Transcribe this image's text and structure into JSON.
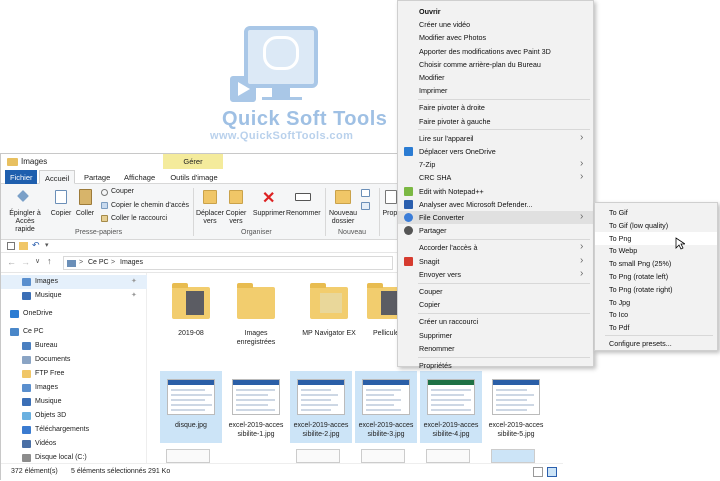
{
  "brand": {
    "title": "Quick Soft Tools",
    "url": "www.QuickSoftTools.com"
  },
  "explorer": {
    "window_title": "Images",
    "contextual_tab_header": "Gérer",
    "tabs": [
      "Fichier",
      "Accueil",
      "Partage",
      "Affichage",
      "Outils d'image"
    ],
    "ribbon": {
      "pin": "Épingler à Accès rapide",
      "copy": "Copier",
      "paste": "Coller",
      "cut": "Couper",
      "copy_path": "Copier le chemin d'accès",
      "paste_shortcut": "Coller le raccourci",
      "group_clipboard": "Presse-papiers",
      "move_to": "Déplacer vers",
      "copy_to": "Copier vers",
      "delete": "Supprimer",
      "rename": "Renommer",
      "group_organize": "Organiser",
      "new_folder": "Nouveau dossier",
      "group_new": "Nouveau",
      "props": "Propr"
    },
    "address": {
      "pc": "Ce PC",
      "sep": ">",
      "folder": "Images"
    },
    "nav_items": [
      {
        "label": "Images",
        "icon": "images-icon"
      },
      {
        "label": "Musique",
        "icon": "music-icon"
      },
      {
        "label": "OneDrive",
        "icon": "onedrive-icon"
      },
      {
        "label": "Ce PC",
        "icon": "pc-icon"
      },
      {
        "label": "Bureau",
        "icon": "desktop-icon"
      },
      {
        "label": "Documents",
        "icon": "documents-icon"
      },
      {
        "label": "FTP Free",
        "icon": "folder-icon"
      },
      {
        "label": "Images",
        "icon": "images-icon"
      },
      {
        "label": "Musique",
        "icon": "music-icon"
      },
      {
        "label": "Objets 3D",
        "icon": "objects3d-icon"
      },
      {
        "label": "Téléchargements",
        "icon": "download-icon"
      },
      {
        "label": "Vidéos",
        "icon": "videos-icon"
      },
      {
        "label": "Disque local (C:)",
        "icon": "disk-icon"
      }
    ],
    "files": [
      {
        "name": "2019-08",
        "kind": "folder",
        "selected": false
      },
      {
        "name": "Images enregistrées",
        "kind": "folder",
        "selected": false
      },
      {
        "name": "MP Navigator EX",
        "kind": "folder",
        "selected": false
      },
      {
        "name": "Pellicule",
        "kind": "folder",
        "selected": false
      },
      {
        "name": "disque.jpg",
        "kind": "image",
        "selected": true
      },
      {
        "name": "excel-2019-accessibilite-1.jpg",
        "kind": "image",
        "selected": false
      },
      {
        "name": "excel-2019-accessibilite-2.jpg",
        "kind": "image",
        "selected": true
      },
      {
        "name": "excel-2019-accessibilite-3.jpg",
        "kind": "image",
        "selected": true
      },
      {
        "name": "excel-2019-accessibilite-4.jpg",
        "kind": "image",
        "selected": true
      },
      {
        "name": "excel-2019-accessibilite-5.jpg",
        "kind": "image",
        "selected": false
      }
    ],
    "file_labels": [
      [
        "2019-08"
      ],
      [
        "Images",
        "enregistrées"
      ],
      [
        "MP Navigator EX"
      ],
      [
        "Pellicule"
      ],
      [
        "disque.jpg"
      ],
      [
        "excel-2019-acces",
        "sibilite-1.jpg"
      ],
      [
        "excel-2019-acces",
        "sibilite-2.jpg"
      ],
      [
        "excel-2019-acces",
        "sibilite-3.jpg"
      ],
      [
        "excel-2019-acces",
        "sibilite-4.jpg"
      ],
      [
        "excel-2019-acces",
        "sibilite-5.jpg"
      ]
    ],
    "status": {
      "count": "372 élément(s)",
      "selection": "5 éléments sélectionnés  291 Ko"
    }
  },
  "context_menu": {
    "items": [
      {
        "label": "Ouvrir",
        "bold": true
      },
      {
        "label": "Créer une vidéo"
      },
      {
        "label": "Modifier avec Photos"
      },
      {
        "label": "Apporter des modifications avec Paint 3D"
      },
      {
        "label": "Choisir comme arrière-plan du Bureau"
      },
      {
        "label": "Modifier"
      },
      {
        "label": "Imprimer"
      },
      {
        "label": "Faire pivoter à droite"
      },
      {
        "label": "Faire pivoter à gauche"
      },
      {
        "label": "Lire sur l'appareil",
        "submenu": true
      },
      {
        "label": "Déplacer vers OneDrive",
        "icon": "onedrive-icon"
      },
      {
        "label": "7-Zip",
        "submenu": true
      },
      {
        "label": "CRC SHA",
        "submenu": true
      },
      {
        "label": "Edit with Notepad++",
        "icon": "notepad-icon"
      },
      {
        "label": "Analyser avec Microsoft Defender...",
        "icon": "defender-icon"
      },
      {
        "label": "File Converter",
        "submenu": true,
        "highlighted": true,
        "icon": "file-converter-icon"
      },
      {
        "label": "Partager",
        "icon": "share-icon"
      },
      {
        "label": "Accorder l'accès à",
        "submenu": true
      },
      {
        "label": "Snagit",
        "submenu": true,
        "icon": "snagit-icon"
      },
      {
        "label": "Envoyer vers",
        "submenu": true
      },
      {
        "label": "Couper"
      },
      {
        "label": "Copier"
      },
      {
        "label": "Créer un raccourci"
      },
      {
        "label": "Supprimer"
      },
      {
        "label": "Renommer"
      },
      {
        "label": "Propriétés"
      }
    ],
    "submenu_title": "File Converter",
    "submenu_items": [
      "To Gif",
      "To Gif (low quality)",
      "To Png",
      "To Webp",
      "To small Png (25%)",
      "To Png (rotate left)",
      "To Png (rotate right)",
      "To Jpg",
      "To Ico",
      "To Pdf",
      "Configure presets..."
    ],
    "submenu_highlighted": "To Png"
  },
  "colors": {
    "accent": "#1e5fae",
    "selection": "#cce4f7",
    "manage_tab": "#f4eb9c",
    "folder": "#f2cd6e"
  }
}
